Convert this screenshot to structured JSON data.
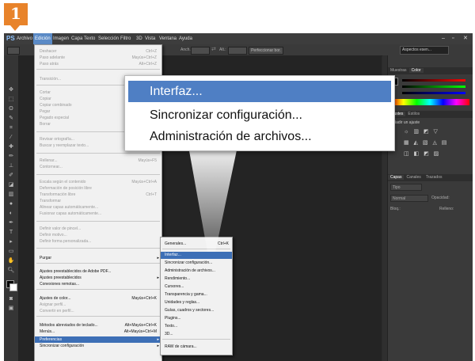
{
  "step_number": "1",
  "menubar": {
    "logo": "PS",
    "items": [
      {
        "label": "Archivo"
      },
      {
        "label": "Edición",
        "active": true
      },
      {
        "label": "Imagen"
      },
      {
        "label": "Capa"
      },
      {
        "label": "Texto"
      },
      {
        "label": "Selección"
      },
      {
        "label": "Filtro"
      },
      {
        "label": "3D"
      },
      {
        "label": "Vista"
      },
      {
        "label": "Ventana"
      },
      {
        "label": "Ayuda"
      }
    ],
    "window_controls": [
      "–",
      "▫",
      "✕"
    ]
  },
  "options_bar": {
    "anch_label": "Anch.:",
    "alt_label": "Alt.:",
    "refine_label": "Perfeccionar bor.",
    "workspace_label": "Aspectos esen..."
  },
  "edit_menu": {
    "items": [
      {
        "label": "Deshacer",
        "shortcut": "Ctrl+Z",
        "disabled": true
      },
      {
        "label": "Paso adelante",
        "shortcut": "Mayús+Ctrl+Z",
        "disabled": true
      },
      {
        "label": "Paso atrás",
        "shortcut": "Alt+Ctrl+Z",
        "disabled": true
      },
      {
        "label": "Transición...",
        "shortcut": "Mayús+Ctrl+F",
        "disabled": true
      },
      {
        "label": "Cortar",
        "shortcut": "",
        "disabled": true
      },
      {
        "label": "Copiar",
        "shortcut": "",
        "disabled": true
      },
      {
        "label": "Copiar combinado",
        "shortcut": "",
        "disabled": true
      },
      {
        "label": "Pegar",
        "shortcut": "",
        "disabled": true
      },
      {
        "label": "Pegado especial",
        "shortcut": "",
        "disabled": true
      },
      {
        "label": "Borrar",
        "shortcut": "",
        "disabled": true
      },
      {
        "label": "Revisar ortografía...",
        "shortcut": "",
        "disabled": true
      },
      {
        "label": "Buscar y reemplazar texto...",
        "shortcut": "",
        "disabled": true
      },
      {
        "label": "Rellenar...",
        "shortcut": "Mayús+F5",
        "disabled": true
      },
      {
        "label": "Contornear...",
        "shortcut": "",
        "disabled": true
      },
      {
        "label": "Escala según el contenido",
        "shortcut": "Mayús+Ctrl+A",
        "disabled": true
      },
      {
        "label": "Deformación de posición libre",
        "shortcut": "",
        "disabled": true
      },
      {
        "label": "Transformación libre",
        "shortcut": "Ctrl+T",
        "disabled": true
      },
      {
        "label": "Transformar",
        "shortcut": "",
        "disabled": true
      },
      {
        "label": "Alinear capas automáticamente...",
        "shortcut": "",
        "disabled": true
      },
      {
        "label": "Fusionar capas automáticamente...",
        "shortcut": "",
        "disabled": true
      },
      {
        "label": "Definir valor de pincel...",
        "shortcut": "",
        "disabled": true
      },
      {
        "label": "Definir motivo...",
        "shortcut": "",
        "disabled": true
      },
      {
        "label": "Definir forma personalizada...",
        "shortcut": "",
        "disabled": true
      },
      {
        "label": "Purgar",
        "shortcut": "",
        "disabled": false,
        "submenu": true
      },
      {
        "label": "Ajustes preestablecidos de Adobe PDF...",
        "shortcut": "",
        "disabled": false
      },
      {
        "label": "Ajustes preestablecidos",
        "shortcut": "",
        "disabled": false,
        "submenu": true
      },
      {
        "label": "Conexiones remotas...",
        "shortcut": "",
        "disabled": false
      },
      {
        "label": "Ajustes de color...",
        "shortcut": "Mayús+Ctrl+K",
        "disabled": false
      },
      {
        "label": "Asignar perfil...",
        "shortcut": "",
        "disabled": true
      },
      {
        "label": "Convertir en perfil...",
        "shortcut": "",
        "disabled": true
      },
      {
        "label": "Métodos abreviados de teclado...",
        "shortcut": "Alt+Mayús+Ctrl+K",
        "disabled": false
      },
      {
        "label": "Menús...",
        "shortcut": "Alt+Mayús+Ctrl+M",
        "disabled": false
      },
      {
        "label": "Preferencias",
        "shortcut": "",
        "disabled": false,
        "submenu": true,
        "highlighted": true
      },
      {
        "label": "Sincronizar configuración",
        "shortcut": "",
        "disabled": false,
        "submenu": true
      }
    ]
  },
  "preferences_submenu": {
    "items": [
      {
        "label": "Generales...",
        "shortcut": "Ctrl+K"
      },
      {
        "label": "Interfaz...",
        "shortcut": "",
        "highlighted": true
      },
      {
        "label": "Sincronizar configuración...",
        "shortcut": ""
      },
      {
        "label": "Administración de archivos...",
        "shortcut": ""
      },
      {
        "label": "Rendimiento...",
        "shortcut": ""
      },
      {
        "label": "Cursores...",
        "shortcut": ""
      },
      {
        "label": "Transparencia y gama...",
        "shortcut": ""
      },
      {
        "label": "Unidades y reglas...",
        "shortcut": ""
      },
      {
        "label": "Guías, cuadros y sectores...",
        "shortcut": ""
      },
      {
        "label": "Plugins...",
        "shortcut": ""
      },
      {
        "label": "Texto...",
        "shortcut": ""
      },
      {
        "label": "3D...",
        "shortcut": ""
      },
      {
        "label": "RAW de cámara...",
        "shortcut": ""
      }
    ]
  },
  "zoom_callout": {
    "items": [
      {
        "label": "Interfaz...",
        "highlighted": true
      },
      {
        "label": "Sincronizar configuración..."
      },
      {
        "label": "Administración de archivos..."
      }
    ]
  },
  "panels": {
    "top_tabs": [
      "Muestras",
      "Color"
    ],
    "adjust_tabs": [
      "Ajustes",
      "Estilos"
    ],
    "adjust_title": "Añadir un ajuste",
    "layers_tabs": [
      "Capas",
      "Canales",
      "Trazados"
    ],
    "kind_label": "Tipo",
    "blend_mode": "Normal",
    "opacity_label": "Opacidad:",
    "lock_label": "Bloq.:",
    "fill_label": "Relleno:"
  },
  "colors": {
    "highlight": "#3d6fb6",
    "callout_highlight": "#4f7fc4",
    "step_badge": "#e8832a"
  }
}
